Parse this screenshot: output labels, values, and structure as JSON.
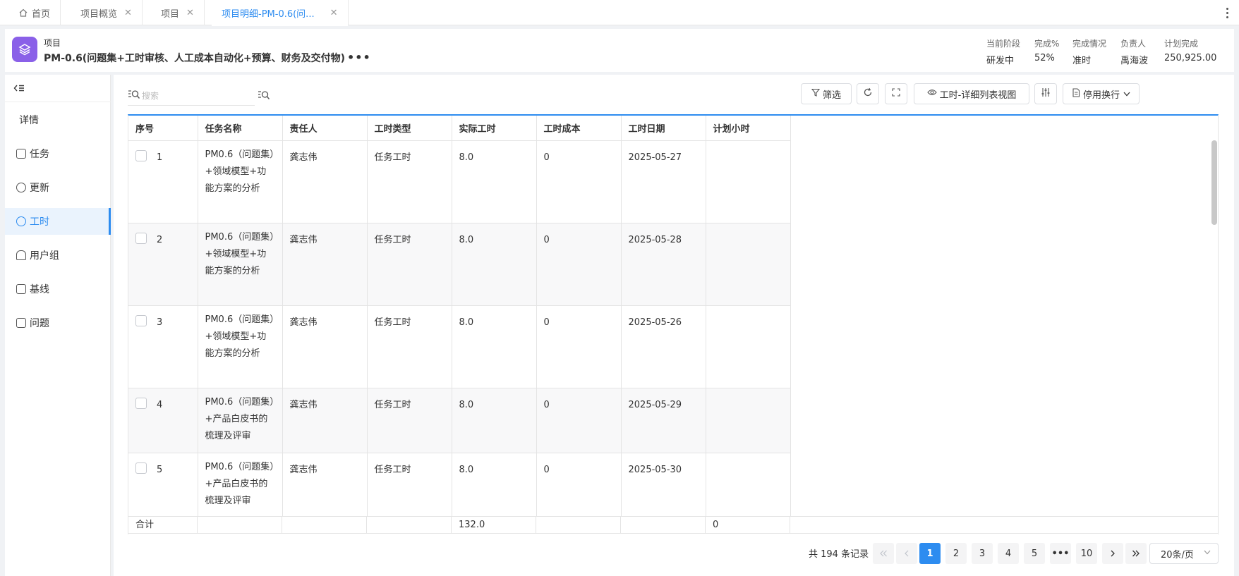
{
  "tabs": [
    {
      "label": "首页",
      "closable": false,
      "active": false
    },
    {
      "label": "项目概览",
      "closable": true,
      "active": false
    },
    {
      "label": "项目",
      "closable": true,
      "active": false
    },
    {
      "label": "项目明细-PM-0.6(问...",
      "closable": true,
      "active": true
    }
  ],
  "header": {
    "category": "项目",
    "name": "PM-0.6(问题集+工时审核、人工成本自动化+预算、财务及交付物)",
    "more": "•••",
    "meta": [
      {
        "label": "当前阶段",
        "value": "研发中"
      },
      {
        "label": "完成%",
        "value": "52%"
      },
      {
        "label": "完成情况",
        "value": "准时"
      },
      {
        "label": "负责人",
        "value": "禹海波"
      },
      {
        "label": "计划完成",
        "value": "250,925.00"
      }
    ]
  },
  "sidebar": {
    "collapse_icon": "collapse-left-icon",
    "items": [
      {
        "label": "详情",
        "icon": ""
      },
      {
        "label": "任务",
        "icon": "task-icon"
      },
      {
        "label": "更新",
        "icon": "update-icon"
      },
      {
        "label": "工时",
        "icon": "clock-icon",
        "active": true
      },
      {
        "label": "用户组",
        "icon": "users-icon"
      },
      {
        "label": "基线",
        "icon": "edit-icon"
      },
      {
        "label": "问题",
        "icon": "issue-icon"
      }
    ]
  },
  "toolbar": {
    "search_placeholder": "搜索",
    "filter_label": "筛选",
    "view_label": "工时-详细列表视图",
    "wrap_label": "停用换行"
  },
  "table": {
    "columns": [
      "序号",
      "任务名称",
      "责任人",
      "工时类型",
      "实际工时",
      "工时成本",
      "工时日期",
      "计划小时"
    ],
    "rows": [
      {
        "idx": "1",
        "task": "PM0.6（问题集）+领域模型+功能方案的分析",
        "owner": "龚志伟",
        "type": "任务工时",
        "actual": "8.0",
        "cost": "0",
        "date": "2025-05-27",
        "plan": ""
      },
      {
        "idx": "2",
        "task": "PM0.6（问题集）+领域模型+功能方案的分析",
        "owner": "龚志伟",
        "type": "任务工时",
        "actual": "8.0",
        "cost": "0",
        "date": "2025-05-28",
        "plan": ""
      },
      {
        "idx": "3",
        "task": "PM0.6（问题集）+领域模型+功能方案的分析",
        "owner": "龚志伟",
        "type": "任务工时",
        "actual": "8.0",
        "cost": "0",
        "date": "2025-05-26",
        "plan": ""
      },
      {
        "idx": "4",
        "task": "PM0.6（问题集）+产品白皮书的梳理及评审",
        "owner": "龚志伟",
        "type": "任务工时",
        "actual": "8.0",
        "cost": "0",
        "date": "2025-05-29",
        "plan": ""
      },
      {
        "idx": "5",
        "task": "PM0.6（问题集）+产品白皮书的梳理及评审",
        "owner": "龚志伟",
        "type": "任务工时",
        "actual": "8.0",
        "cost": "0",
        "date": "2025-05-30",
        "plan": ""
      }
    ],
    "total": {
      "label": "合计",
      "actual": "132.0",
      "plan": "0"
    }
  },
  "pagination": {
    "total_text": "共 194 条记录",
    "pages": [
      "1",
      "2",
      "3",
      "4",
      "5",
      "•••",
      "10"
    ],
    "current": "1",
    "page_size": "20条/页"
  }
}
